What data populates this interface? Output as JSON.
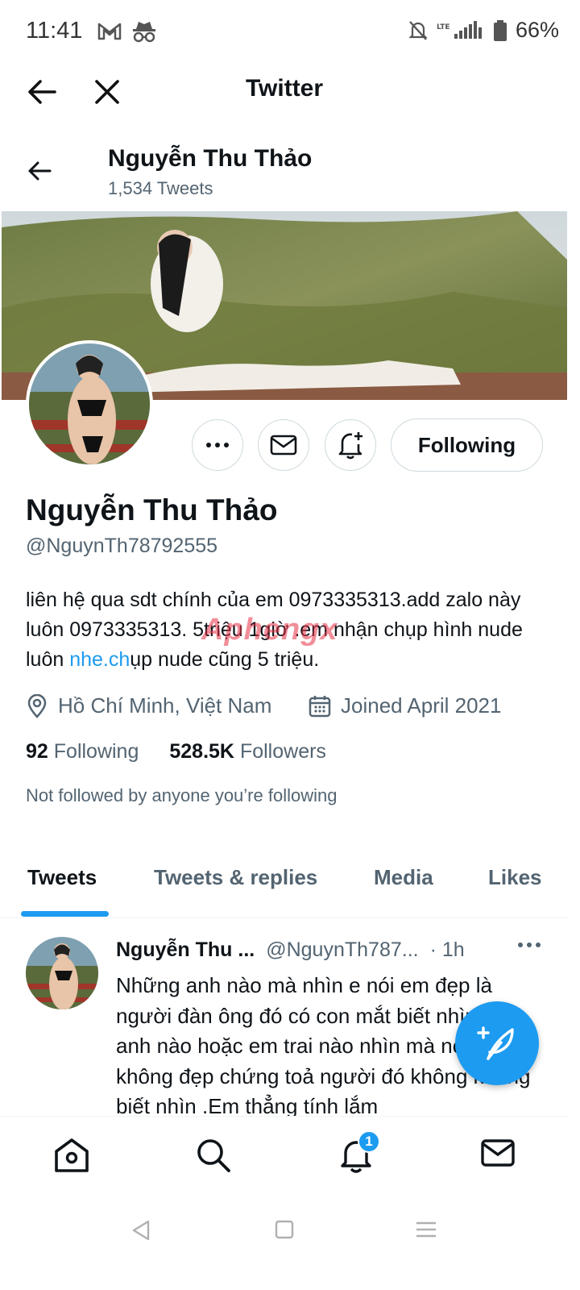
{
  "status_bar": {
    "time": "11:41",
    "battery": "66%",
    "icons": [
      "gmail-icon",
      "incognito-icon",
      "mute-icon",
      "lte-signal-icon",
      "signal-icon",
      "battery-icon"
    ]
  },
  "browser_header": {
    "title": "Twitter"
  },
  "profile_topbar": {
    "name": "Nguyễn Thu Thảo",
    "tweet_count": "1,534 Tweets"
  },
  "profile": {
    "name": "Nguyễn Thu Thảo",
    "handle": "@NguynTh78792555",
    "bio_before_link": "liên hệ qua sdt chính của em 0973335313.add zalo này luôn 0973335313. 5triệu 1giờ .em nhận chụp hình nude luôn ",
    "bio_link": "nhe.ch",
    "bio_after_link": "ụp nude cũng 5 triệu.",
    "watermark": "Aphengx",
    "location": "Hồ Chí Minh, Việt Nam",
    "joined": "Joined April 2021",
    "following_count": "92",
    "following_label": "Following",
    "followers_count": "528.5K",
    "followers_label": "Followers",
    "not_followed_note": "Not followed by anyone you’re following",
    "following_button": "Following"
  },
  "tabs": [
    {
      "label": "Tweets",
      "active": true
    },
    {
      "label": "Tweets & replies",
      "active": false
    },
    {
      "label": "Media",
      "active": false
    },
    {
      "label": "Likes",
      "active": false
    }
  ],
  "tweet": {
    "name": "Nguyễn Thu ...",
    "handle": "@NguynTh787...",
    "time": "· 1h",
    "text": "Những anh nào mà nhìn e nói em đẹp là người đàn ông đó có con mắt biết nhìn. Còn anh nào hoặc em trai nào nhìn mà nói em không đẹp chứng toả người đó không không biết nhìn .Em thẳng tính lắm"
  },
  "bottom_nav": {
    "notification_badge": "1"
  },
  "colors": {
    "accent": "#1d9bf0",
    "text_primary": "#0f1419",
    "text_secondary": "#536471",
    "border": "#cfd9de"
  }
}
